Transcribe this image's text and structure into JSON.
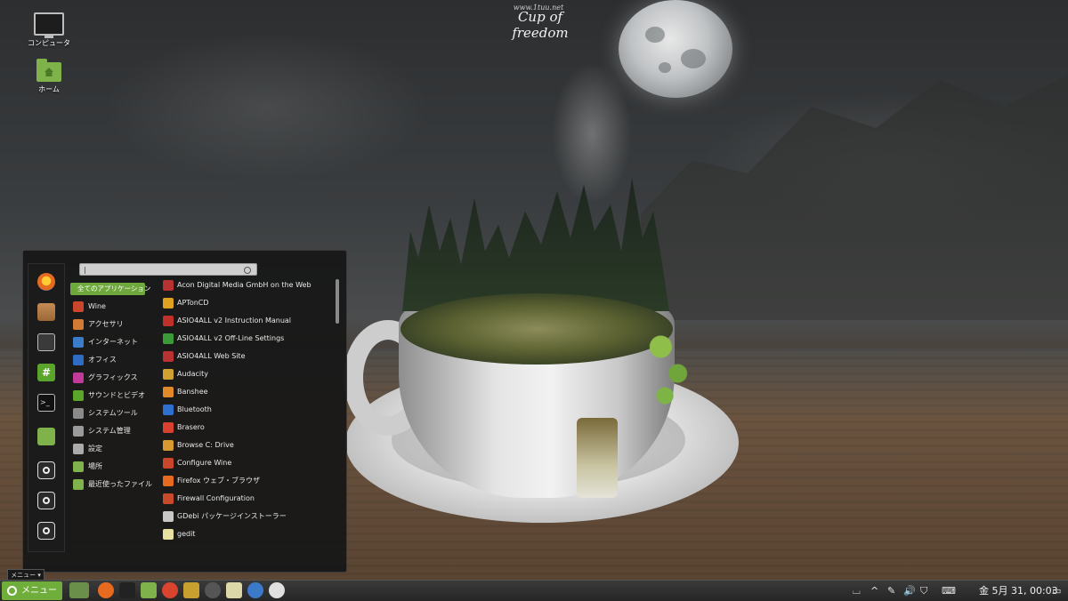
{
  "wallpaper": {
    "title": "Cup of freedom",
    "url": "www.1tuu.net"
  },
  "desktop_icons": [
    {
      "label": "コンピュータ",
      "icon": "computer-icon"
    },
    {
      "label": "ホーム",
      "icon": "home-folder-icon"
    }
  ],
  "menu": {
    "search": {
      "value": "|"
    },
    "favorites": [
      {
        "icon": "firefox-icon"
      },
      {
        "icon": "software-manager-icon"
      },
      {
        "icon": "system-settings-icon"
      },
      {
        "icon": "terminal-green-icon"
      },
      {
        "icon": "terminal-icon"
      },
      {
        "icon": "files-icon"
      },
      {
        "icon": "lock-screen-icon"
      },
      {
        "icon": "logout-icon"
      },
      {
        "icon": "shutdown-icon"
      }
    ],
    "categories": [
      {
        "label": "全てのアプリケーション",
        "active": true,
        "color": "#6fa93d"
      },
      {
        "label": "Wine",
        "color": "#c9452b"
      },
      {
        "label": "アクセサリ",
        "color": "#d07a33"
      },
      {
        "label": "インターネット",
        "color": "#3b7cc9"
      },
      {
        "label": "オフィス",
        "color": "#2e6cc4"
      },
      {
        "label": "グラフィックス",
        "color": "#c33b9a"
      },
      {
        "label": "サウンドとビデオ",
        "color": "#5aa62a"
      },
      {
        "label": "システムツール",
        "color": "#8a8a8a"
      },
      {
        "label": "システム管理",
        "color": "#9a9a9a"
      },
      {
        "label": "設定",
        "color": "#aaaaaa"
      },
      {
        "label": "場所",
        "color": "#7fb24a"
      },
      {
        "label": "最近使ったファイル",
        "color": "#7fb24a"
      }
    ],
    "applications": [
      {
        "label": "Acon Digital Media GmbH on the Web",
        "color": "#b83232"
      },
      {
        "label": "APTonCD",
        "color": "#e0a020"
      },
      {
        "label": "ASIO4ALL v2 Instruction Manual",
        "color": "#c0302a"
      },
      {
        "label": "ASIO4ALL v2 Off-Line Settings",
        "color": "#3a9a3a"
      },
      {
        "label": "ASIO4ALL Web Site",
        "color": "#b83232"
      },
      {
        "label": "Audacity",
        "color": "#d0a030"
      },
      {
        "label": "Banshee",
        "color": "#e08a2a"
      },
      {
        "label": "Bluetooth",
        "color": "#2f6fd0"
      },
      {
        "label": "Brasero",
        "color": "#d84030"
      },
      {
        "label": "Browse C: Drive",
        "color": "#d89a30"
      },
      {
        "label": "Configure Wine",
        "color": "#c9452b"
      },
      {
        "label": "Firefox ウェブ・ブラウザ",
        "color": "#e66a1f"
      },
      {
        "label": "Firewall Configuration",
        "color": "#c84a2a"
      },
      {
        "label": "GDebi パッケージインストーラー",
        "color": "#c8c8c8"
      },
      {
        "label": "gedit",
        "color": "#e8e0a0"
      }
    ]
  },
  "tooltip": "メニュー",
  "panel": {
    "menu_button": "メニュー",
    "launchers": [
      {
        "icon": "show-desktop-icon",
        "color": "#6a8f4a"
      },
      {
        "icon": "firefox-icon",
        "color": "#e66a1f"
      },
      {
        "icon": "terminal-icon",
        "color": "#222222"
      },
      {
        "icon": "files-icon",
        "color": "#7fb24a"
      },
      {
        "icon": "chrome-icon",
        "color": "#d9442e"
      },
      {
        "icon": "graphics-icon",
        "color": "#c8a030"
      },
      {
        "icon": "camera-icon",
        "color": "#555555"
      },
      {
        "icon": "text-editor-icon",
        "color": "#dcd8a8"
      },
      {
        "icon": "kde-connect-icon",
        "color": "#3a7ac8"
      },
      {
        "icon": "photos-icon",
        "color": "#e0e0e0"
      }
    ],
    "clock": "金  5月 31, 00:03"
  }
}
